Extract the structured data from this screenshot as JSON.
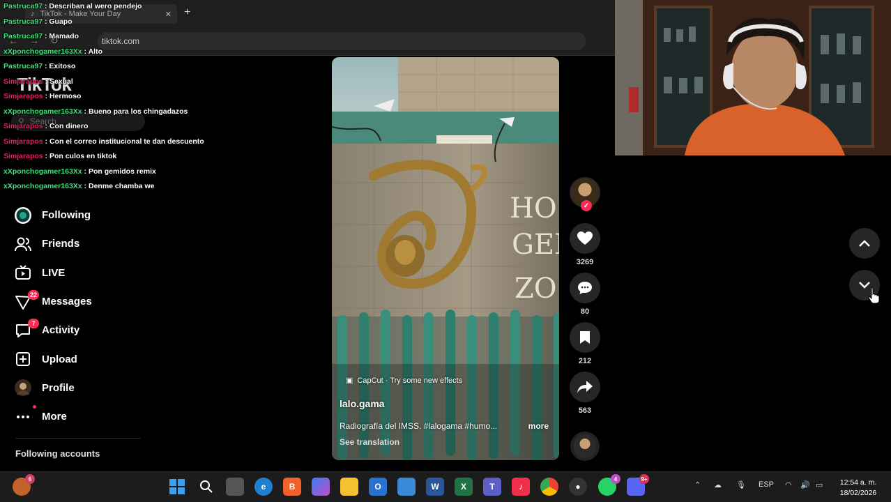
{
  "browser": {
    "tab_title": "TikTok - Make Your Day",
    "url": "tiktok.com"
  },
  "sidebar": {
    "logo": "TikTok",
    "search_placeholder": "Search",
    "items": [
      {
        "label": "Following",
        "icon": "following-icon"
      },
      {
        "label": "Friends",
        "icon": "friends-icon"
      },
      {
        "label": "LIVE",
        "icon": "live-icon"
      },
      {
        "label": "Messages",
        "icon": "messages-icon",
        "badge": "22"
      },
      {
        "label": "Activity",
        "icon": "activity-icon",
        "badge": "7"
      },
      {
        "label": "Upload",
        "icon": "upload-icon"
      },
      {
        "label": "Profile",
        "icon": "profile-avatar"
      },
      {
        "label": "More",
        "icon": "more-icon"
      }
    ],
    "following_accounts": "Following accounts"
  },
  "chat": [
    {
      "user": "Pastruca97",
      "msg": "Describan al wero pendejo",
      "color": "#3ee07a"
    },
    {
      "user": "Pastruca97",
      "msg": "Guapo",
      "color": "#3ee07a"
    },
    {
      "user": "Pastruca97",
      "msg": "Mamado",
      "color": "#3ee07a"
    },
    {
      "user": "xXponchogamer163Xx",
      "msg": "Alto",
      "color": "#3ee07a"
    },
    {
      "user": "Pastruca97",
      "msg": "Exitoso",
      "color": "#3ee07a"
    },
    {
      "user": "Simjarapos",
      "msg": "Sexual",
      "color": "#e0245e"
    },
    {
      "user": "Simjarapos",
      "msg": "Hermoso",
      "color": "#e0245e"
    },
    {
      "user": "xXponchogamer163Xx",
      "msg": "Bueno para los chingadazos",
      "color": "#3ee07a"
    },
    {
      "user": "Simjarapos",
      "msg": "Con dinero",
      "color": "#e0245e"
    },
    {
      "user": "Simjarapos",
      "msg": "Con el correo institucional te dan descuento",
      "color": "#e0245e"
    },
    {
      "user": "Simjarapos",
      "msg": "Pon culos en tiktok",
      "color": "#e0245e"
    },
    {
      "user": "xXponchogamer163Xx",
      "msg": "Pon gemidos remix",
      "color": "#3ee07a"
    },
    {
      "user": "xXponchogamer163Xx",
      "msg": "Denme chamba we",
      "color": "#3ee07a"
    }
  ],
  "video": {
    "capcut": "CapCut · Try some new effects",
    "username": "lalo.gama",
    "description": "Radiografía del IMSS. #lalogama #humo...",
    "more": "more",
    "see_translation": "See translation",
    "sign_letters": [
      "HOS",
      "GEN",
      "ZO"
    ]
  },
  "actions": {
    "likes": "3269",
    "comments": "80",
    "saves": "212",
    "shares": "563"
  },
  "taskbar": {
    "start_badge": "6",
    "teams_badge": "4",
    "discord_badge": "9+",
    "language": "ESP",
    "time": "12:54 a. m.",
    "date": "18/02/2026"
  },
  "colors": {
    "accent": "#fe2c55",
    "background": "#000000"
  }
}
